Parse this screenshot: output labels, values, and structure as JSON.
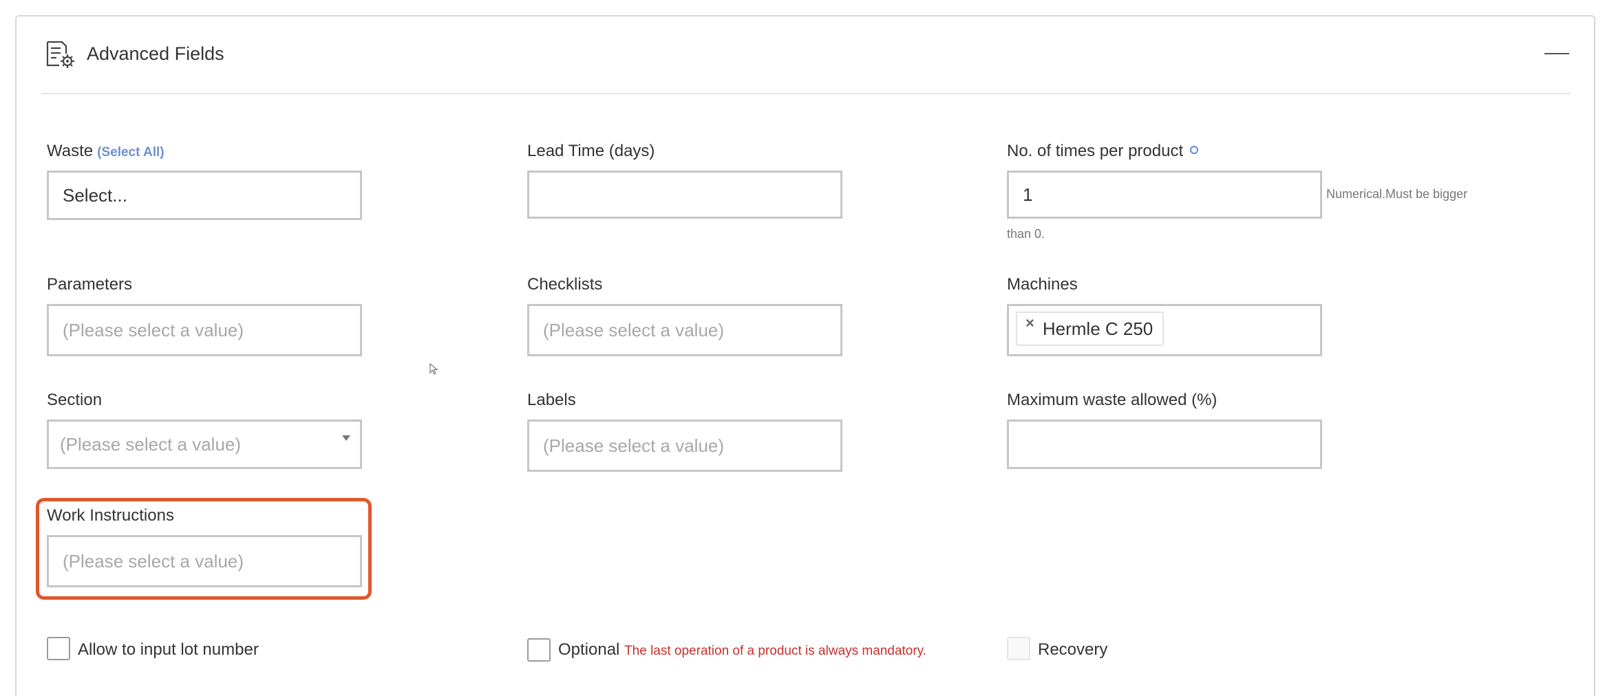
{
  "header": {
    "title": "Advanced Fields",
    "icon": "form-settings-icon",
    "collapse_icon": "minus-icon"
  },
  "fields": {
    "waste": {
      "label": "Waste",
      "select_all": "(Select All)",
      "value": "Select..."
    },
    "lead_time": {
      "label": "Lead Time (days)",
      "value": ""
    },
    "times_per_product": {
      "label": "No. of times per product",
      "value": "1",
      "hint_line1": "Numerical.Must be bigger",
      "hint_line2": "than 0."
    },
    "parameters": {
      "label": "Parameters",
      "placeholder": "(Please select a value)"
    },
    "checklists": {
      "label": "Checklists",
      "placeholder": "(Please select a value)"
    },
    "machines": {
      "label": "Machines",
      "tags": [
        "Hermle C 250"
      ],
      "tag_remove": "×"
    },
    "section": {
      "label": "Section",
      "placeholder": "(Please select a value)"
    },
    "labels": {
      "label": "Labels",
      "placeholder": "(Please select a value)"
    },
    "max_waste": {
      "label": "Maximum waste allowed (%)",
      "value": ""
    },
    "work_instructions": {
      "label": "Work Instructions",
      "placeholder": "(Please select a value)"
    }
  },
  "checkboxes": {
    "lot_number": {
      "label": "Allow to input lot number",
      "checked": false
    },
    "optional": {
      "label": "Optional",
      "warning": "The last operation of a product is always mandatory.",
      "checked": false
    },
    "recovery": {
      "label": "Recovery",
      "checked": false,
      "disabled": true
    }
  },
  "colors": {
    "highlight": "#e0572a",
    "link": "#6f8fd0",
    "warning": "#c9302c",
    "border": "#c6c6c6"
  }
}
